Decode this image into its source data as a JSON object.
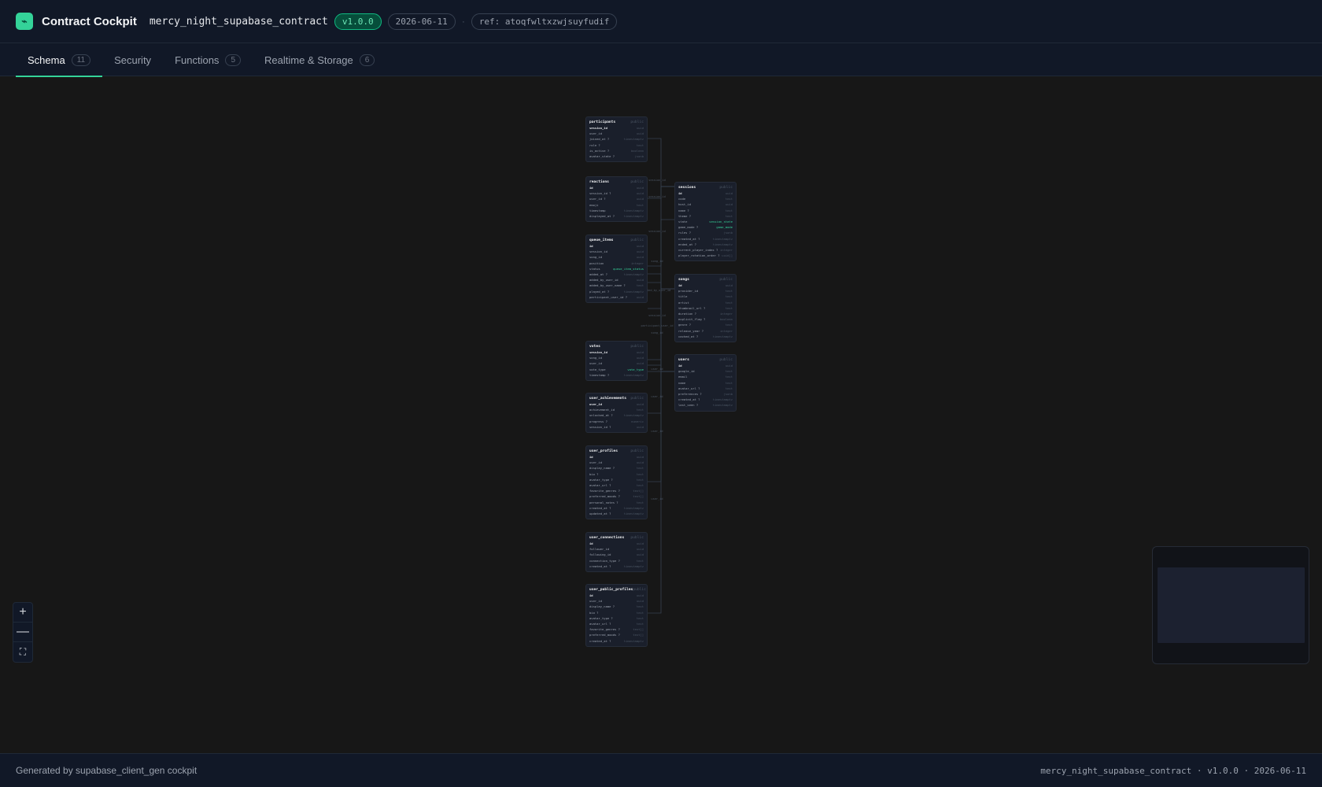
{
  "header": {
    "logo_glyph": "⌁",
    "title": "Contract Cockpit",
    "project": "mercy_night_supabase_contract",
    "version": "v1.0.0",
    "date": "2026-06-11",
    "separator": "·",
    "ref": "ref: atoqfwltxzwjsuyfudif"
  },
  "tabs": [
    {
      "label": "Schema",
      "count": "11"
    },
    {
      "label": "Security",
      "count": ""
    },
    {
      "label": "Functions",
      "count": "5"
    },
    {
      "label": "Realtime & Storage",
      "count": "6"
    }
  ],
  "colors": {
    "accent": "#34d399",
    "background": "#171717",
    "panel": "#111827"
  },
  "tables": [
    {
      "name": "participants",
      "schema": "public",
      "columns": [
        {
          "name": "session_id",
          "type": "uuid",
          "pk": true
        },
        {
          "name": "user_id",
          "type": "uuid"
        },
        {
          "name": "joined_at ?",
          "type": "timestamptz"
        },
        {
          "name": "role ?",
          "type": "text"
        },
        {
          "name": "is_active ?",
          "type": "boolean"
        },
        {
          "name": "avatar_state ?",
          "type": "jsonb"
        }
      ]
    },
    {
      "name": "reactions",
      "schema": "public",
      "columns": [
        {
          "name": "id",
          "type": "uuid",
          "pk": true
        },
        {
          "name": "session_id ?",
          "type": "uuid"
        },
        {
          "name": "user_id ?",
          "type": "uuid"
        },
        {
          "name": "emoji",
          "type": "text"
        },
        {
          "name": "timestamp",
          "type": "timestamptz"
        },
        {
          "name": "displayed_at ?",
          "type": "timestamptz"
        }
      ]
    },
    {
      "name": "queue_items",
      "schema": "public",
      "columns": [
        {
          "name": "id",
          "type": "uuid",
          "pk": true
        },
        {
          "name": "session_id",
          "type": "uuid"
        },
        {
          "name": "song_id",
          "type": "uuid"
        },
        {
          "name": "position",
          "type": "integer"
        },
        {
          "name": "status",
          "type": "queue_item_status",
          "enum": true
        },
        {
          "name": "added_at ?",
          "type": "timestamptz"
        },
        {
          "name": "added_by_user_id",
          "type": "uuid"
        },
        {
          "name": "added_by_user_name ?",
          "type": "text"
        },
        {
          "name": "played_at ?",
          "type": "timestamptz"
        },
        {
          "name": "participant_user_id ?",
          "type": "uuid"
        }
      ]
    },
    {
      "name": "votes",
      "schema": "public",
      "columns": [
        {
          "name": "session_id",
          "type": "uuid",
          "pk": true
        },
        {
          "name": "song_id",
          "type": "uuid"
        },
        {
          "name": "user_id",
          "type": "uuid"
        },
        {
          "name": "vote_type",
          "type": "vote_type",
          "enum": true
        },
        {
          "name": "timestamp ?",
          "type": "timestamptz"
        }
      ]
    },
    {
      "name": "user_achievements",
      "schema": "public",
      "columns": [
        {
          "name": "user_id",
          "type": "uuid",
          "pk": true
        },
        {
          "name": "achievement_id",
          "type": "text"
        },
        {
          "name": "unlocked_at ?",
          "type": "timestamptz"
        },
        {
          "name": "progress ?",
          "type": "numeric"
        },
        {
          "name": "session_id ?",
          "type": "uuid"
        }
      ]
    },
    {
      "name": "user_profiles",
      "schema": "public",
      "columns": [
        {
          "name": "id",
          "type": "uuid",
          "pk": true
        },
        {
          "name": "user_id",
          "type": "uuid"
        },
        {
          "name": "display_name ?",
          "type": "text"
        },
        {
          "name": "bio ?",
          "type": "text"
        },
        {
          "name": "avatar_type ?",
          "type": "text"
        },
        {
          "name": "avatar_url ?",
          "type": "text"
        },
        {
          "name": "favorite_genres ?",
          "type": "text[]"
        },
        {
          "name": "preferred_moods ?",
          "type": "text[]"
        },
        {
          "name": "personal_notes ?",
          "type": "text"
        },
        {
          "name": "created_at ?",
          "type": "timestamptz"
        },
        {
          "name": "updated_at ?",
          "type": "timestamptz"
        }
      ]
    },
    {
      "name": "user_connections",
      "schema": "public",
      "columns": [
        {
          "name": "id",
          "type": "uuid",
          "pk": true
        },
        {
          "name": "follower_id",
          "type": "uuid"
        },
        {
          "name": "following_id",
          "type": "uuid"
        },
        {
          "name": "connection_type ?",
          "type": "text"
        },
        {
          "name": "created_at ?",
          "type": "timestamptz"
        }
      ]
    },
    {
      "name": "user_public_profiles",
      "schema": "public",
      "columns": [
        {
          "name": "id",
          "type": "uuid",
          "pk": true
        },
        {
          "name": "user_id",
          "type": "uuid"
        },
        {
          "name": "display_name ?",
          "type": "text"
        },
        {
          "name": "bio ?",
          "type": "text"
        },
        {
          "name": "avatar_type ?",
          "type": "text"
        },
        {
          "name": "avatar_url ?",
          "type": "text"
        },
        {
          "name": "favorite_genres ?",
          "type": "text[]"
        },
        {
          "name": "preferred_moods ?",
          "type": "text[]"
        },
        {
          "name": "created_at ?",
          "type": "timestamptz"
        }
      ]
    },
    {
      "name": "sessions",
      "schema": "public",
      "columns": [
        {
          "name": "id",
          "type": "uuid",
          "pk": true
        },
        {
          "name": "code",
          "type": "text"
        },
        {
          "name": "host_id",
          "type": "uuid"
        },
        {
          "name": "name ?",
          "type": "text"
        },
        {
          "name": "theme ?",
          "type": "text"
        },
        {
          "name": "state",
          "type": "session_state",
          "enum": true
        },
        {
          "name": "game_mode ?",
          "type": "game_mode",
          "enum": true
        },
        {
          "name": "rules ?",
          "type": "jsonb"
        },
        {
          "name": "created_at ?",
          "type": "timestamptz"
        },
        {
          "name": "ended_at ?",
          "type": "timestamptz"
        },
        {
          "name": "current_player_index ?",
          "type": "integer"
        },
        {
          "name": "player_rotation_order ?",
          "type": "uuid[]"
        }
      ]
    },
    {
      "name": "songs",
      "schema": "public",
      "columns": [
        {
          "name": "id",
          "type": "uuid",
          "pk": true
        },
        {
          "name": "provider_id",
          "type": "text"
        },
        {
          "name": "title",
          "type": "text"
        },
        {
          "name": "artist",
          "type": "text"
        },
        {
          "name": "thumbnail_url ?",
          "type": "text"
        },
        {
          "name": "duration ?",
          "type": "integer"
        },
        {
          "name": "explicit_flag ?",
          "type": "boolean"
        },
        {
          "name": "genre ?",
          "type": "text"
        },
        {
          "name": "release_year ?",
          "type": "integer"
        },
        {
          "name": "cached_at ?",
          "type": "timestamptz"
        }
      ]
    },
    {
      "name": "users",
      "schema": "public",
      "columns": [
        {
          "name": "id",
          "type": "uuid",
          "pk": true
        },
        {
          "name": "google_id",
          "type": "text"
        },
        {
          "name": "email",
          "type": "text"
        },
        {
          "name": "name",
          "type": "text"
        },
        {
          "name": "avatar_url ?",
          "type": "text"
        },
        {
          "name": "preferences ?",
          "type": "jsonb"
        },
        {
          "name": "created_at ?",
          "type": "timestamptz"
        },
        {
          "name": "last_seen ?",
          "type": "timestamptz"
        }
      ]
    }
  ],
  "edge_labels": [
    "session_id",
    "session_id",
    "session_id",
    "song_id",
    "added_by_user_id",
    "participant_user_id",
    "session_id",
    "song_id",
    "user_id",
    "user_id",
    "user_id",
    "user_id"
  ],
  "zoom": {
    "in_glyph": "+",
    "out_glyph": "—",
    "fit_glyph": "⛶"
  },
  "footer": {
    "left": "Generated by supabase_client_gen cockpit",
    "right": "mercy_night_supabase_contract · v1.0.0 · 2026-06-11"
  }
}
